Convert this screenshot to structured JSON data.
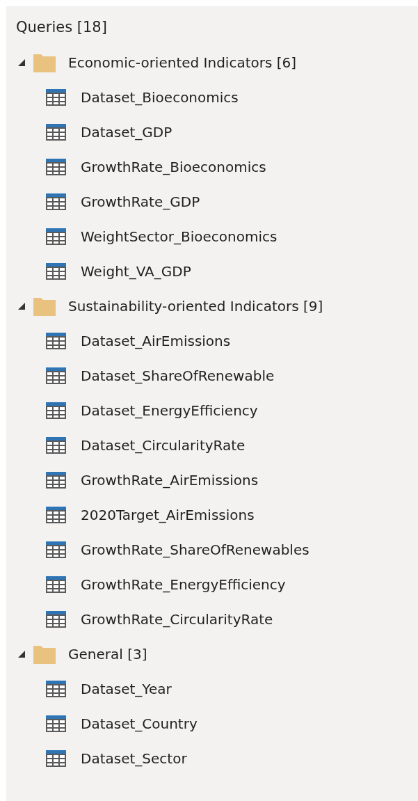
{
  "panel": {
    "title": "Queries [18]"
  },
  "groups": [
    {
      "label": "Economic-oriented Indicators [6]",
      "expanded": true,
      "children": [
        {
          "label": "Dataset_Bioeconomics"
        },
        {
          "label": "Dataset_GDP"
        },
        {
          "label": "GrowthRate_Bioeconomics"
        },
        {
          "label": "GrowthRate_GDP"
        },
        {
          "label": "WeightSector_Bioeconomics"
        },
        {
          "label": "Weight_VA_GDP"
        }
      ]
    },
    {
      "label": "Sustainability-oriented Indicators [9]",
      "expanded": true,
      "children": [
        {
          "label": "Dataset_AirEmissions"
        },
        {
          "label": "Dataset_ShareOfRenewable"
        },
        {
          "label": "Dataset_EnergyEfficiency"
        },
        {
          "label": "Dataset_CircularityRate"
        },
        {
          "label": "GrowthRate_AirEmissions"
        },
        {
          "label": "2020Target_AirEmissions"
        },
        {
          "label": "GrowthRate_ShareOfRenewables"
        },
        {
          "label": "GrowthRate_EnergyEfficiency"
        },
        {
          "label": "GrowthRate_CircularityRate"
        }
      ]
    },
    {
      "label": "General [3]",
      "expanded": true,
      "children": [
        {
          "label": "Dataset_Year"
        },
        {
          "label": "Dataset_Country"
        },
        {
          "label": "Dataset_Sector"
        }
      ]
    }
  ]
}
